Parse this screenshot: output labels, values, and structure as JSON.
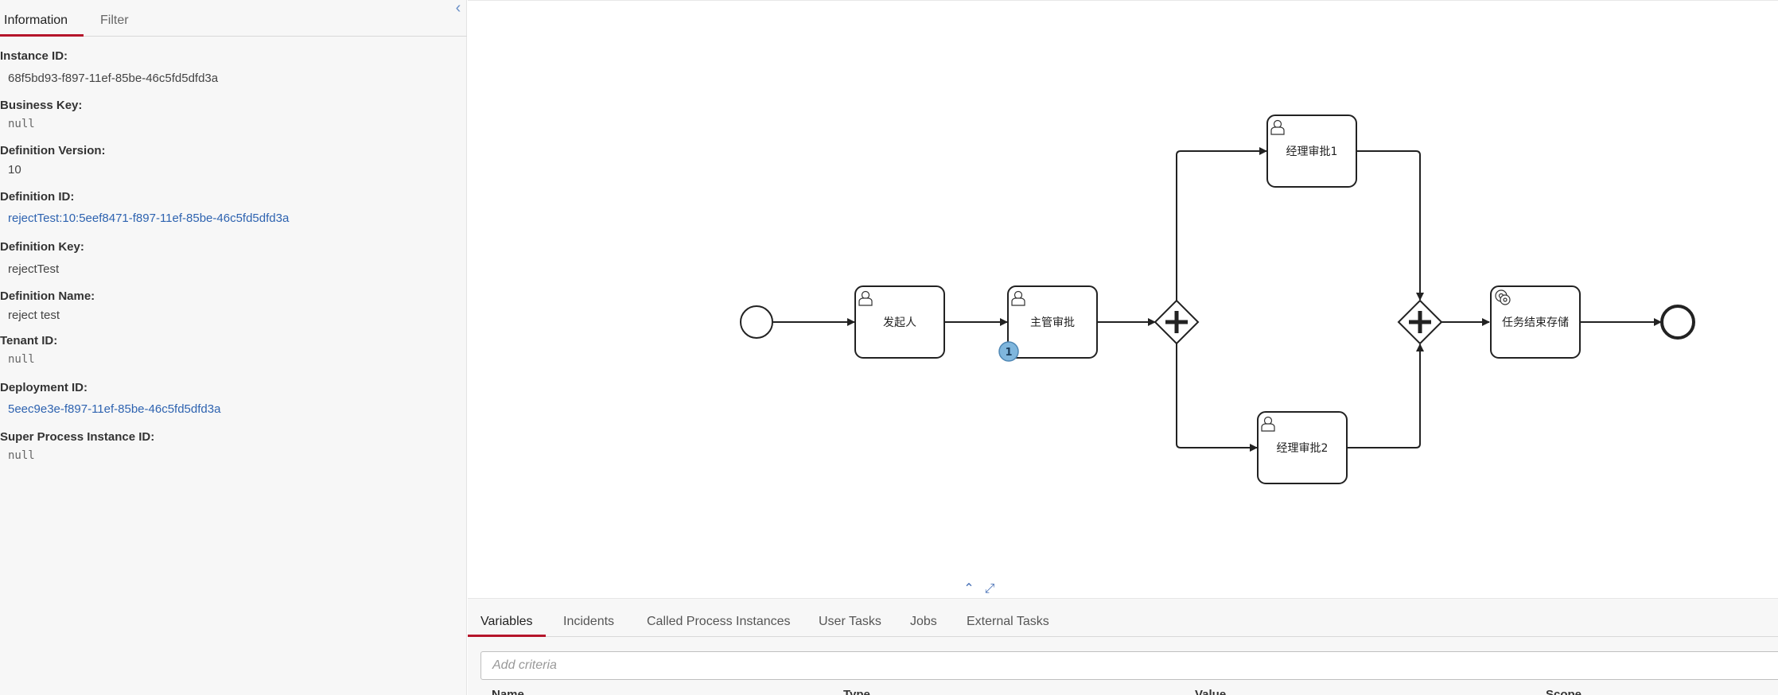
{
  "sidebar": {
    "tabs": [
      "Information",
      "Filter"
    ],
    "collapse_icon": "chevron-left-icon",
    "fields": [
      {
        "label": "Instance ID:",
        "value": "68f5bd93-f897-11ef-85be-46c5fd5dfd3a",
        "style": "plain"
      },
      {
        "label": "Business Key:",
        "value": "null",
        "style": "mono"
      },
      {
        "label": "Definition Version:",
        "value": "10",
        "style": "plain"
      },
      {
        "label": "Definition ID:",
        "value": "rejectTest:10:5eef8471-f897-11ef-85be-46c5fd5dfd3a",
        "style": "link"
      },
      {
        "label": "Definition Key:",
        "value": "rejectTest",
        "style": "plain"
      },
      {
        "label": "Definition Name:",
        "value": "reject test",
        "style": "plain"
      },
      {
        "label": "Tenant ID:",
        "value": "null",
        "style": "mono"
      },
      {
        "label": "Deployment ID:",
        "value": "5eec9e3e-f897-11ef-85be-46c5fd5dfd3a",
        "style": "link"
      },
      {
        "label": "Super Process Instance ID:",
        "value": "null",
        "style": "mono"
      }
    ]
  },
  "diagram": {
    "tasks": {
      "initiator": "发起人",
      "supervisor": "主管审批",
      "manager1": "经理审批1",
      "manager2": "经理审批2",
      "store": "任务结束存储"
    },
    "token_count": "1"
  },
  "bottom": {
    "tabs": [
      "Variables",
      "Incidents",
      "Called Process Instances",
      "User Tasks",
      "Jobs",
      "External Tasks"
    ],
    "search_placeholder": "Add criteria",
    "columns": [
      "Name",
      "Type",
      "Value",
      "Scope"
    ]
  }
}
